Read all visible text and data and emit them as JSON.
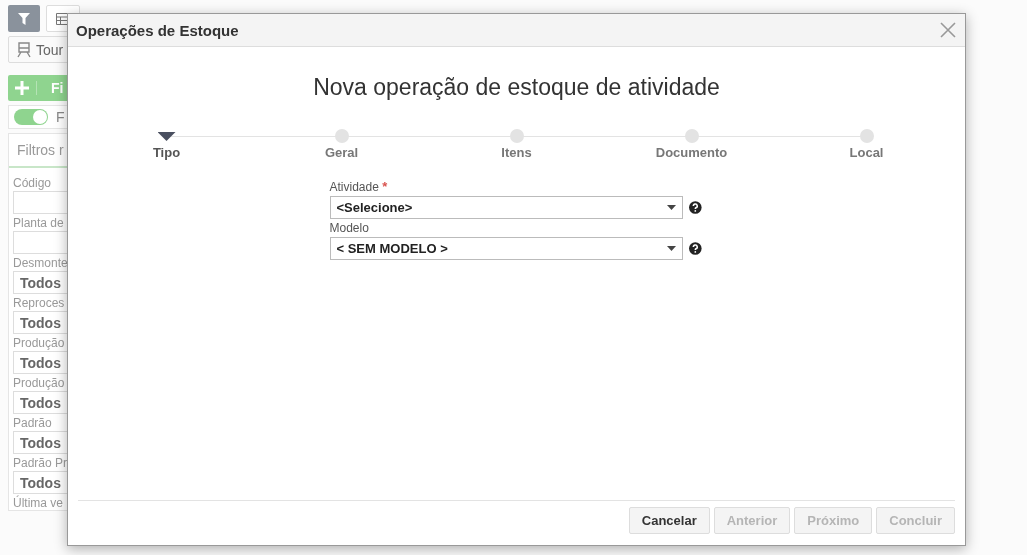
{
  "background": {
    "toolbar": {
      "tour_button": "Tour"
    },
    "add_button": "Fi",
    "toggle": {
      "label": "F",
      "on": true
    },
    "filters": {
      "title": "Filtros r",
      "fields": [
        {
          "kind": "text",
          "label": "Código"
        },
        {
          "kind": "text",
          "label": "Planta de"
        },
        {
          "kind": "select",
          "label": "Desmonte",
          "value": "Todos"
        },
        {
          "kind": "select",
          "label": "Reproces",
          "value": "Todos"
        },
        {
          "kind": "select",
          "label": "Produção",
          "value": "Todos"
        },
        {
          "kind": "select",
          "label": "Produção",
          "value": "Todos"
        },
        {
          "kind": "select",
          "label": "Padrão",
          "value": "Todos"
        },
        {
          "kind": "select",
          "label": "Padrão Pr",
          "value": "Todos"
        },
        {
          "kind": "text_cut",
          "label": "Última ve"
        }
      ]
    }
  },
  "dialog": {
    "title": "Operações de Estoque",
    "heading": "Nova operação de estoque de atividade",
    "steps": [
      {
        "label": "Tipo",
        "selected": true
      },
      {
        "label": "Geral",
        "selected": false
      },
      {
        "label": "Itens",
        "selected": false
      },
      {
        "label": "Documento",
        "selected": false
      },
      {
        "label": "Local",
        "selected": false
      }
    ],
    "fields": [
      {
        "label": "Atividade",
        "required_mark": "*",
        "value": "<Selecione>"
      },
      {
        "label": "Modelo",
        "value": "< SEM MODELO >"
      }
    ],
    "buttons": [
      {
        "label": "Cancelar",
        "disabled": false
      },
      {
        "label": "Anterior",
        "disabled": true
      },
      {
        "label": "Próximo",
        "disabled": true
      },
      {
        "label": "Concluir",
        "disabled": true
      }
    ]
  }
}
